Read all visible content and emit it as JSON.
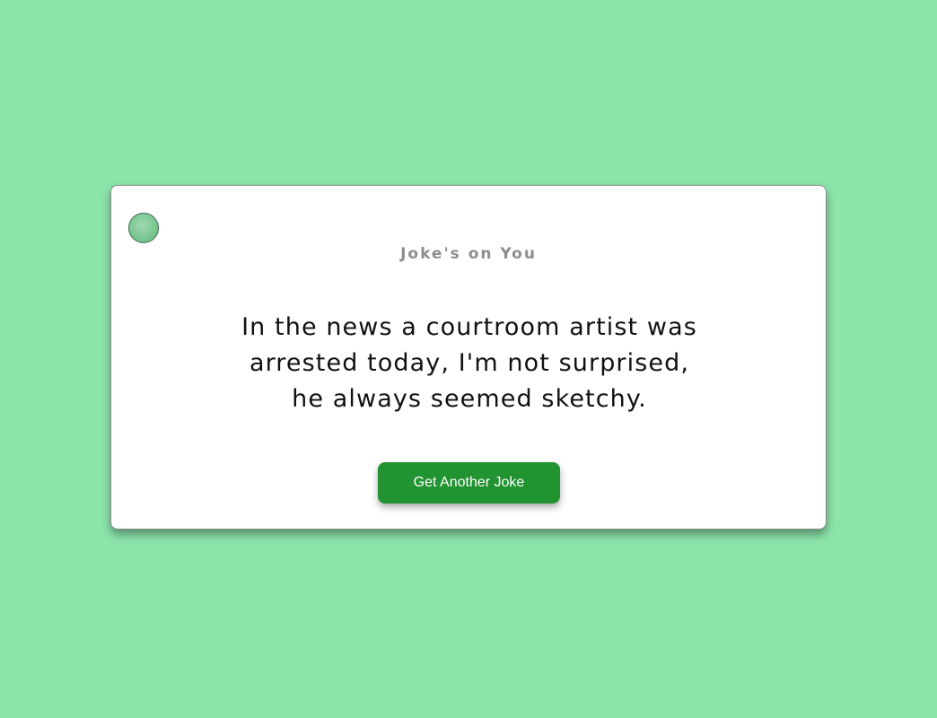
{
  "page": {
    "background_color": "#8be4aa"
  },
  "card": {
    "title": "Joke's on You",
    "joke_text": "In the news a courtroom artist was arrested today, I'm not surprised, he always seemed sketchy.",
    "button_label": "Get Another Joke",
    "button_color": "#229331",
    "decoration_icon": "circle-hole-icon"
  }
}
